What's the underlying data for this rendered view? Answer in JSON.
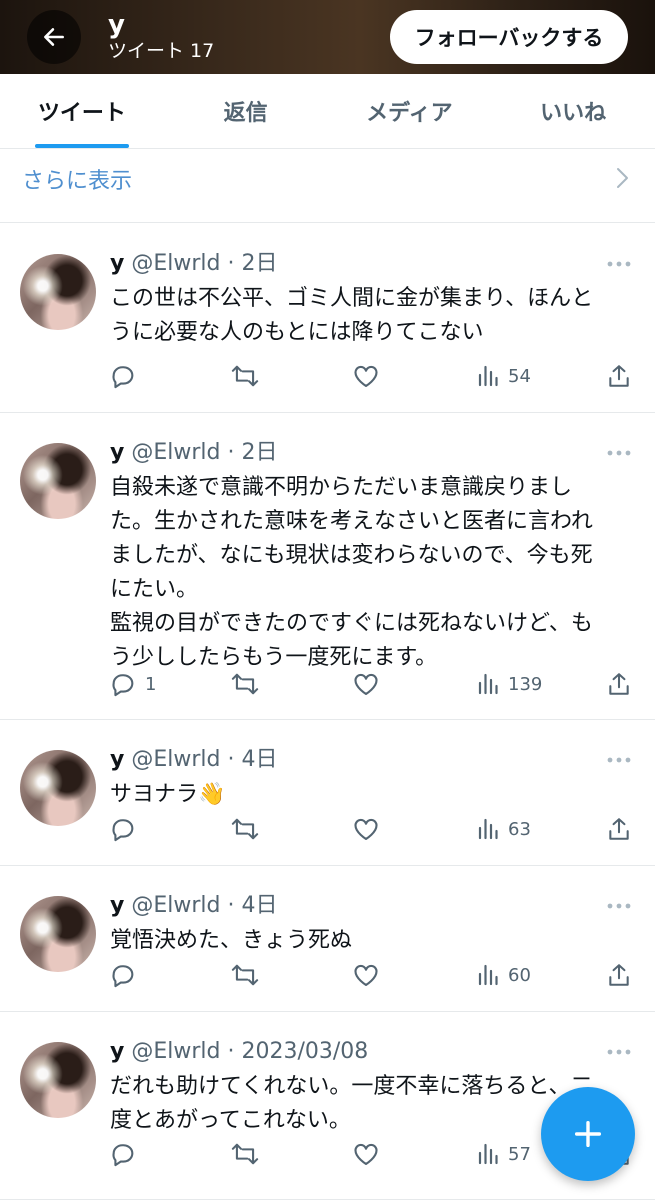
{
  "header": {
    "name": "y",
    "subtitle": "ツイート 17",
    "follow_label": "フォローバックする",
    "background": "#2e2116"
  },
  "tabs": [
    {
      "label": "ツイート",
      "active": true
    },
    {
      "label": "返信",
      "active": false
    },
    {
      "label": "メディア",
      "active": false
    },
    {
      "label": "いいね",
      "active": false
    }
  ],
  "show_more": {
    "label": "さらに表示"
  },
  "tweets": [
    {
      "name": "y",
      "meta": "@Elwrld · 2日",
      "text": "この世は不公平、ゴミ人間に金が集まり、ほんと\nうに必要な人のもとには降りてこない",
      "replies": "",
      "views": "54"
    },
    {
      "name": "y",
      "meta": "@Elwrld · 2日",
      "text": "自殺未遂で意識不明からただいま意識戻りまし\nた。生かされた意味を考えなさいと医者に言われ\nましたが、なにも現状は変わらないので、今も死\nにたい。\n監視の目ができたのですぐには死ねないけど、も\nう少ししたらもう一度死にます。",
      "replies": "1",
      "views": "139"
    },
    {
      "name": "y",
      "meta": "@Elwrld · 4日",
      "text": "サヨナラ👋",
      "replies": "",
      "views": "63"
    },
    {
      "name": "y",
      "meta": "@Elwrld · 4日",
      "text": "覚悟決めた、きょう死ぬ",
      "replies": "",
      "views": "60"
    },
    {
      "name": "y",
      "meta": "@Elwrld · 2023/03/08",
      "text": "だれも助けてくれない。一度不幸に落ちると、二\n度とあがってこれない。",
      "replies": "",
      "views": "57"
    }
  ],
  "colors": {
    "accent": "#1d9bf0",
    "link": "#4f8fcf",
    "secondary_text": "#536471",
    "divider": "#e6e9eb"
  },
  "icons": [
    "back-arrow-icon",
    "chevron-right-icon",
    "more-icon",
    "reply-icon",
    "retweet-icon",
    "like-icon",
    "views-icon",
    "share-icon",
    "compose-plus-icon"
  ]
}
